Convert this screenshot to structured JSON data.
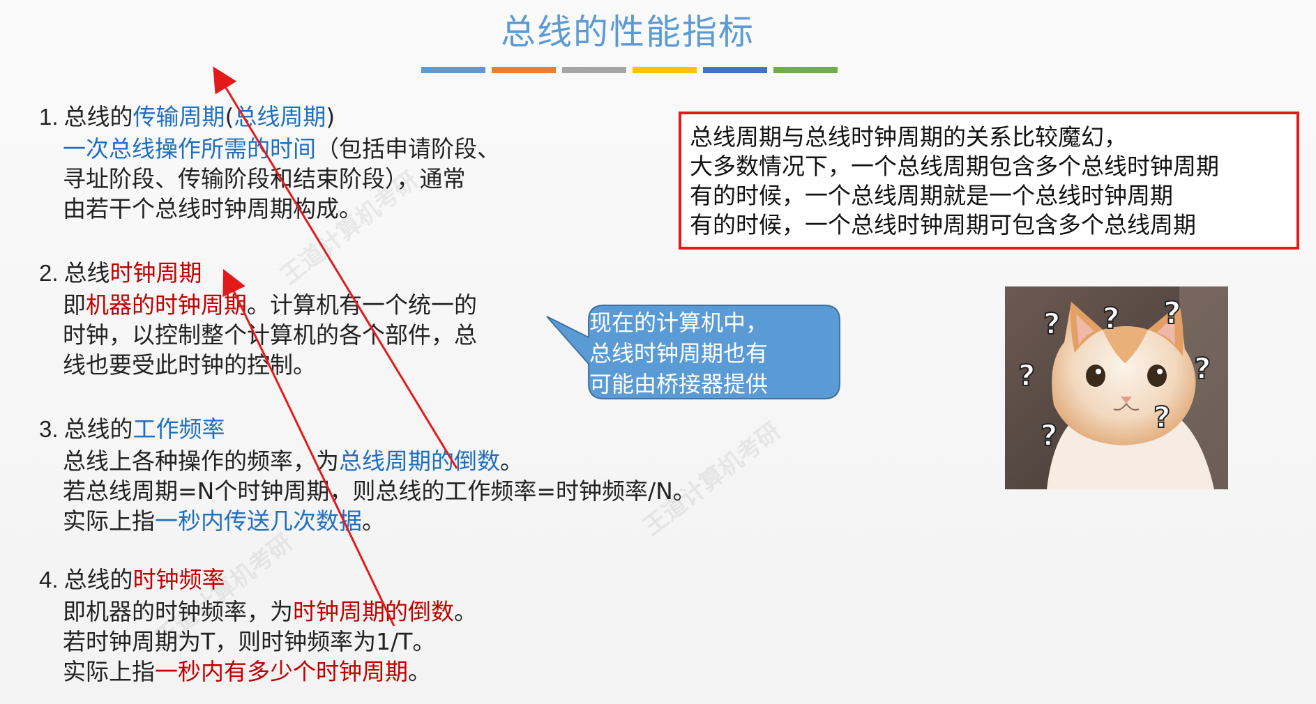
{
  "slide": {
    "title": "总线的性能指标",
    "title_bar_colors": [
      "#5b9bd5",
      "#ed7d31",
      "#a5a5a5",
      "#ffc000",
      "#4472c4",
      "#70ad47"
    ]
  },
  "sections": [
    {
      "number": "1.",
      "heading": {
        "plain": "总线的",
        "highlight": "传输周期",
        "paren_open": "(",
        "paren_highlight": "总线周期",
        "paren_close": ")"
      },
      "lines": [
        {
          "highlight": "一次总线操作所需的时间",
          "plain": "（包括申请阶段、"
        },
        {
          "plain": "寻址阶段、传输阶段和结束阶段），通常"
        },
        {
          "plain": "由若干个总线时钟周期构成。"
        }
      ]
    },
    {
      "number": "2.",
      "heading": {
        "plain": "总线",
        "highlight": "时钟周期"
      },
      "lines": [
        {
          "pre": "即",
          "highlight": "机器的时钟周期",
          "plain": "。计算机有一个统一的"
        },
        {
          "plain": "时钟，以控制整个计算机的各个部件，总"
        },
        {
          "plain": "线也要受此时钟的控制。"
        }
      ]
    },
    {
      "number": "3.",
      "heading": {
        "plain": "总线的",
        "highlight": "工作频率"
      },
      "lines": [
        {
          "pre": "总线上各种操作的频率，为",
          "highlight": "总线周期的倒数",
          "plain": "。"
        },
        {
          "plain": "若总线周期=N个时钟周期，则总线的工作频率=时钟频率/N。"
        },
        {
          "pre": "实际上指",
          "highlight": "一秒内传送几次数据",
          "plain": "。"
        }
      ]
    },
    {
      "number": "4.",
      "heading": {
        "plain": "总线的",
        "highlight": "时钟频率"
      },
      "lines": [
        {
          "pre": "即机器的时钟频率，为",
          "highlight": "时钟周期的倒数",
          "plain": "。"
        },
        {
          "plain": "若时钟周期为T，则时钟频率为1/T。"
        },
        {
          "pre": "实际上指",
          "highlight": "一秒内有多少个时钟周期",
          "plain": "。"
        }
      ]
    }
  ],
  "callout": {
    "lines": [
      "总线周期与总线时钟周期的关系比较魔幻，",
      "大多数情况下，一个总线周期包含多个总线时钟周期",
      "有的时候，一个总线周期就是一个总线时钟周期",
      "有的时候，一个总线时钟周期可包含多个总线周期"
    ]
  },
  "speech_bubble": {
    "lines": [
      "现在的计算机中，",
      "总线时钟周期也有",
      "可能由桥接器提供"
    ],
    "fill": "#5b9bd5"
  },
  "image": {
    "question_mark": "?"
  },
  "watermark": {
    "text": "王道计算机考研"
  },
  "colors": {
    "blue_highlight": "#1f6fc0",
    "red_highlight": "#c00000",
    "arrow": "#e41a1a",
    "box_border": "#e41a1a"
  }
}
